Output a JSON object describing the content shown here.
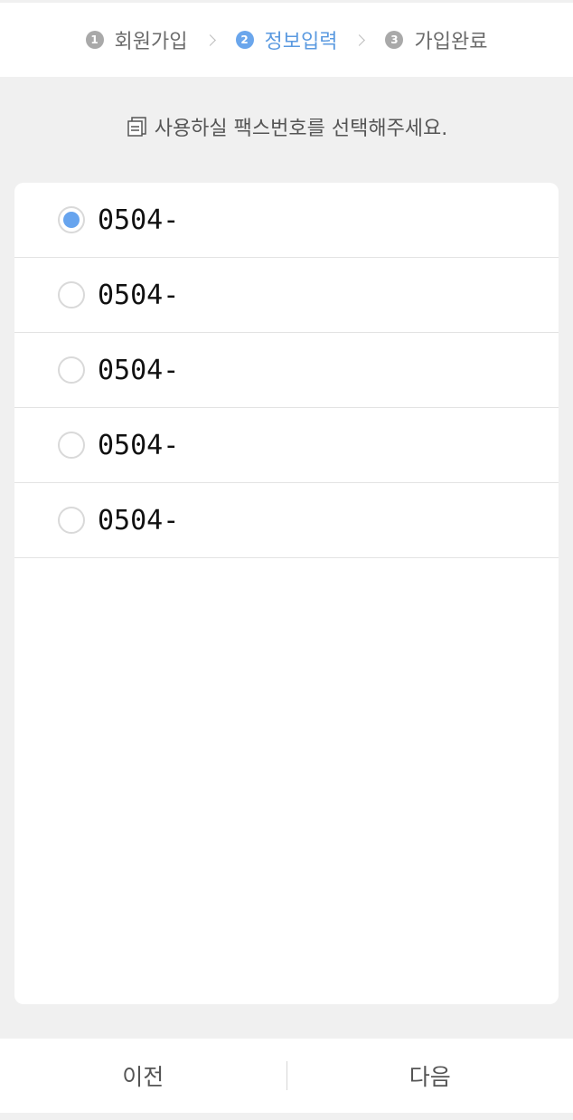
{
  "steps": [
    {
      "num": "1",
      "label": "회원가입"
    },
    {
      "num": "2",
      "label": "정보입력"
    },
    {
      "num": "3",
      "label": "가입완료"
    }
  ],
  "active_step": 2,
  "instruction": "사용하실 팩스번호를 선택해주세요.",
  "instruction_icon": "document-icon",
  "fax_numbers": [
    {
      "number": "0504-",
      "selected": true
    },
    {
      "number": "0504-",
      "selected": false
    },
    {
      "number": "0504-",
      "selected": false
    },
    {
      "number": "0504-",
      "selected": false
    },
    {
      "number": "0504-",
      "selected": false
    }
  ],
  "buttons": {
    "prev_label": "이전",
    "next_label": "다음"
  },
  "colors": {
    "accent": "#5b9ae0",
    "radio_selected": "#67a4ee",
    "background": "#f0f0f0"
  }
}
